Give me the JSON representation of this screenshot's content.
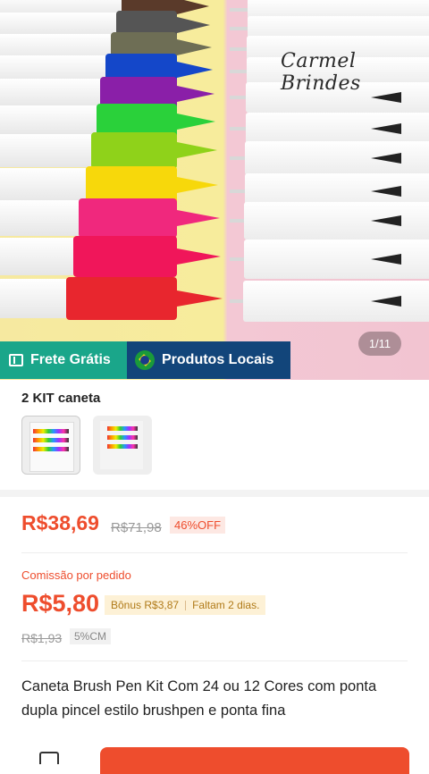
{
  "product_image": {
    "watermark": "Carmel Brindes",
    "counter": "1/11",
    "pen_colors": [
      "#5a3a2a",
      "#555555",
      "#6e6e55",
      "#1447c9",
      "#8a1fa8",
      "#2ad13a",
      "#8fd21a",
      "#f7d80b",
      "#f0287d",
      "#f0165a",
      "#e8262e"
    ],
    "brand_colors": {
      "free_shipping": "#1aa68a",
      "local": "#12457a",
      "accent": "#ee4d2d"
    }
  },
  "badges": {
    "free_shipping": "Frete Grátis",
    "local_products": "Produtos Locais"
  },
  "variant": {
    "title": "2 KIT caneta"
  },
  "pricing": {
    "price": "R$38,69",
    "old_price": "R$71,98",
    "discount": "46%OFF"
  },
  "commission": {
    "label": "Comissão por pedido",
    "value": "R$5,80",
    "bonus": "Bônus R$3,87",
    "remaining": "Faltam 2 dias.",
    "old_value": "R$1,93",
    "rate": "5%CM"
  },
  "product": {
    "title": "Caneta Brush Pen Kit Com 24 ou 12 Cores com ponta dupla pincel estilo brushpen e ponta fina"
  }
}
